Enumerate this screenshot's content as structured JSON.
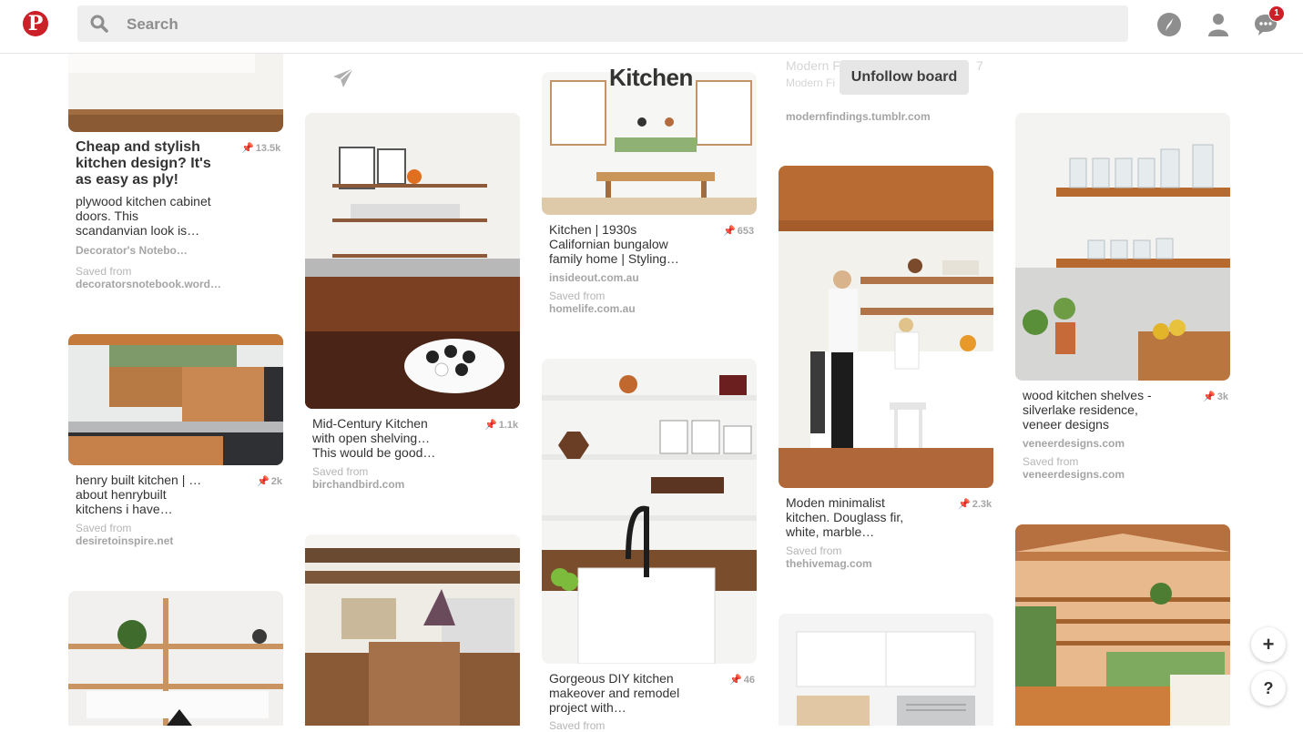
{
  "header": {
    "logo_letter": "P",
    "search_placeholder": "Search",
    "notification_count": "1"
  },
  "board": {
    "title": "Kitchen",
    "unfollow_label": "Unfollow board",
    "faded_text": {
      "col4_line1": "Modern F",
      "col4_line2": "Modern Fi",
      "col4_suffix": "7"
    }
  },
  "pins": [
    {
      "key": "c1p1",
      "title": "Cheap and stylish kitchen design? It's as easy as ply!",
      "description": "plywood kitchen cabinet doors. This scandanvian look is…",
      "saves": "13.5k",
      "source": "Decorator's Notebo…",
      "saved_from_label": "Saved from",
      "saved_from": "decoratorsnotebook.word…"
    },
    {
      "key": "c1p2",
      "description": "henry built kitchen | … about henrybuilt kitchens i have…",
      "saves": "2k",
      "saved_from_label": "Saved from",
      "saved_from": "desiretoinspire.net"
    },
    {
      "key": "c2p1",
      "description": "Mid-Century Kitchen with open shelving… This would be good…",
      "saves": "1.1k",
      "saved_from_label": "Saved from",
      "saved_from": "birchandbird.com"
    },
    {
      "key": "c3p1",
      "description": "Kitchen | 1930s Californian bungalow family home | Styling…",
      "saves": "653",
      "source": "insideout.com.au",
      "saved_from_label": "Saved from",
      "saved_from": "homelife.com.au"
    },
    {
      "key": "c3p2",
      "description": "Gorgeous DIY kitchen makeover and remodel project with…",
      "saves": "46",
      "saved_from_label": "Saved from"
    },
    {
      "key": "c4p0",
      "source": "modernfindings.tumblr.com"
    },
    {
      "key": "c4p1",
      "description": "Moden minimalist kitchen. Douglass fir, white, marble…",
      "saves": "2.3k",
      "saved_from_label": "Saved from",
      "saved_from": "thehivemag.com"
    },
    {
      "key": "c5p1",
      "description": "wood kitchen shelves - silverlake residence, veneer designs",
      "saves": "3k",
      "source": "veneerdesigns.com",
      "saved_from_label": "Saved from",
      "saved_from": "veneerdesigns.com"
    }
  ],
  "fab": {
    "add": "+",
    "help": "?"
  },
  "icons": [
    "pinterest-logo-icon",
    "search-icon",
    "compass-icon",
    "profile-icon",
    "messages-icon",
    "send-icon",
    "pin-count-icon",
    "add-icon",
    "help-icon"
  ],
  "colors": {
    "brand": "#cb2027",
    "search_bg": "#efefef",
    "muted": "#a5a5a5"
  }
}
